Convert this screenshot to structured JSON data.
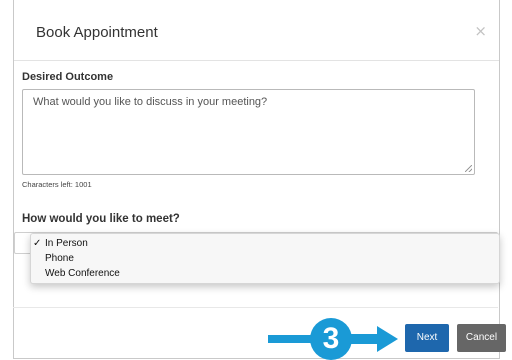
{
  "modal": {
    "title": "Book Appointment",
    "close_glyph": "×"
  },
  "outcome": {
    "label": "Desired Outcome",
    "placeholder": "What would you like to discuss in your meeting?",
    "chars_left": "Characters left:  1001"
  },
  "meeting": {
    "label": "How would you like to meet?",
    "options": [
      "In Person",
      "Phone",
      "Web Conference"
    ],
    "selected": "In Person",
    "check_glyph": "✓"
  },
  "footer": {
    "next_label": "Next",
    "cancel_label": "Cancel",
    "step_number": "3"
  },
  "colors": {
    "primary_button": "#1e67ad",
    "cancel_button": "#666666",
    "annotation_blue": "#1a9ad6"
  },
  "icons": {
    "close": "close-icon",
    "check": "check-icon",
    "resize": "resize-grip-icon",
    "dropdown": "chevron-down-icon",
    "arrow": "arrow-right-icon"
  }
}
